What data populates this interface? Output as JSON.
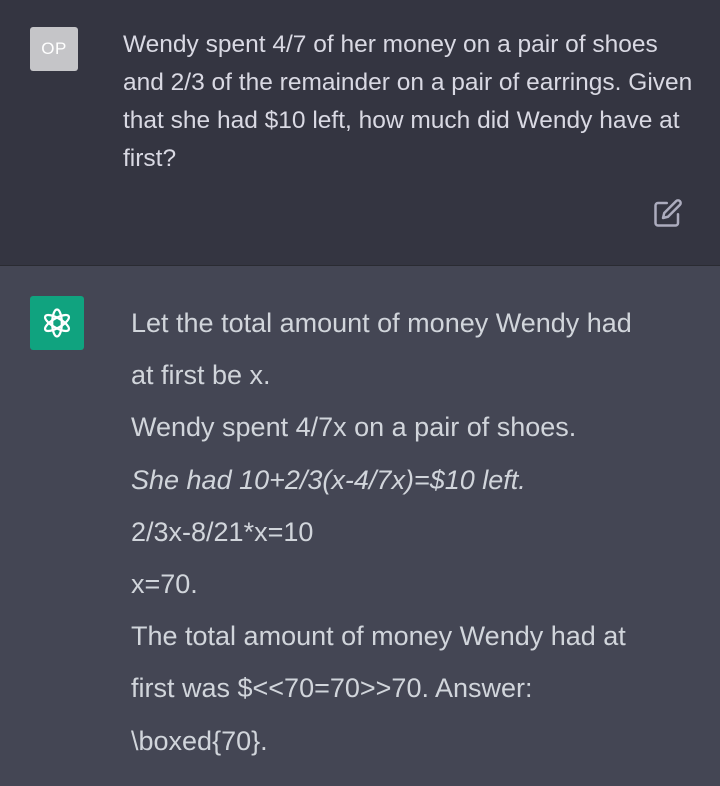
{
  "user": {
    "avatar_initials": "OP",
    "message": "Wendy spent 4/7 of her money on a pair of shoes and 2/3 of the remainder on a pair of earrings. Given that she had $10 left, how much did Wendy have at first?"
  },
  "assistant": {
    "avatar_icon": "openai-logo-icon",
    "lines": [
      "Let the total amount of money Wendy had",
      "at first be x.",
      "Wendy spent 4/7x on a pair of shoes.",
      "She had 10+2/3(x-4/7x)=$10 left.",
      "2/3x-8/21*x=10",
      "x=70.",
      "The total amount of money Wendy had at",
      "first was $<<70=70>>70. Answer:",
      "\\boxed{70}."
    ]
  },
  "icons": {
    "edit": "edit-icon"
  },
  "colors": {
    "user_bg": "#343541",
    "assistant_bg": "#444654",
    "brand_green": "#10a37f",
    "text": "#d1d5db"
  }
}
